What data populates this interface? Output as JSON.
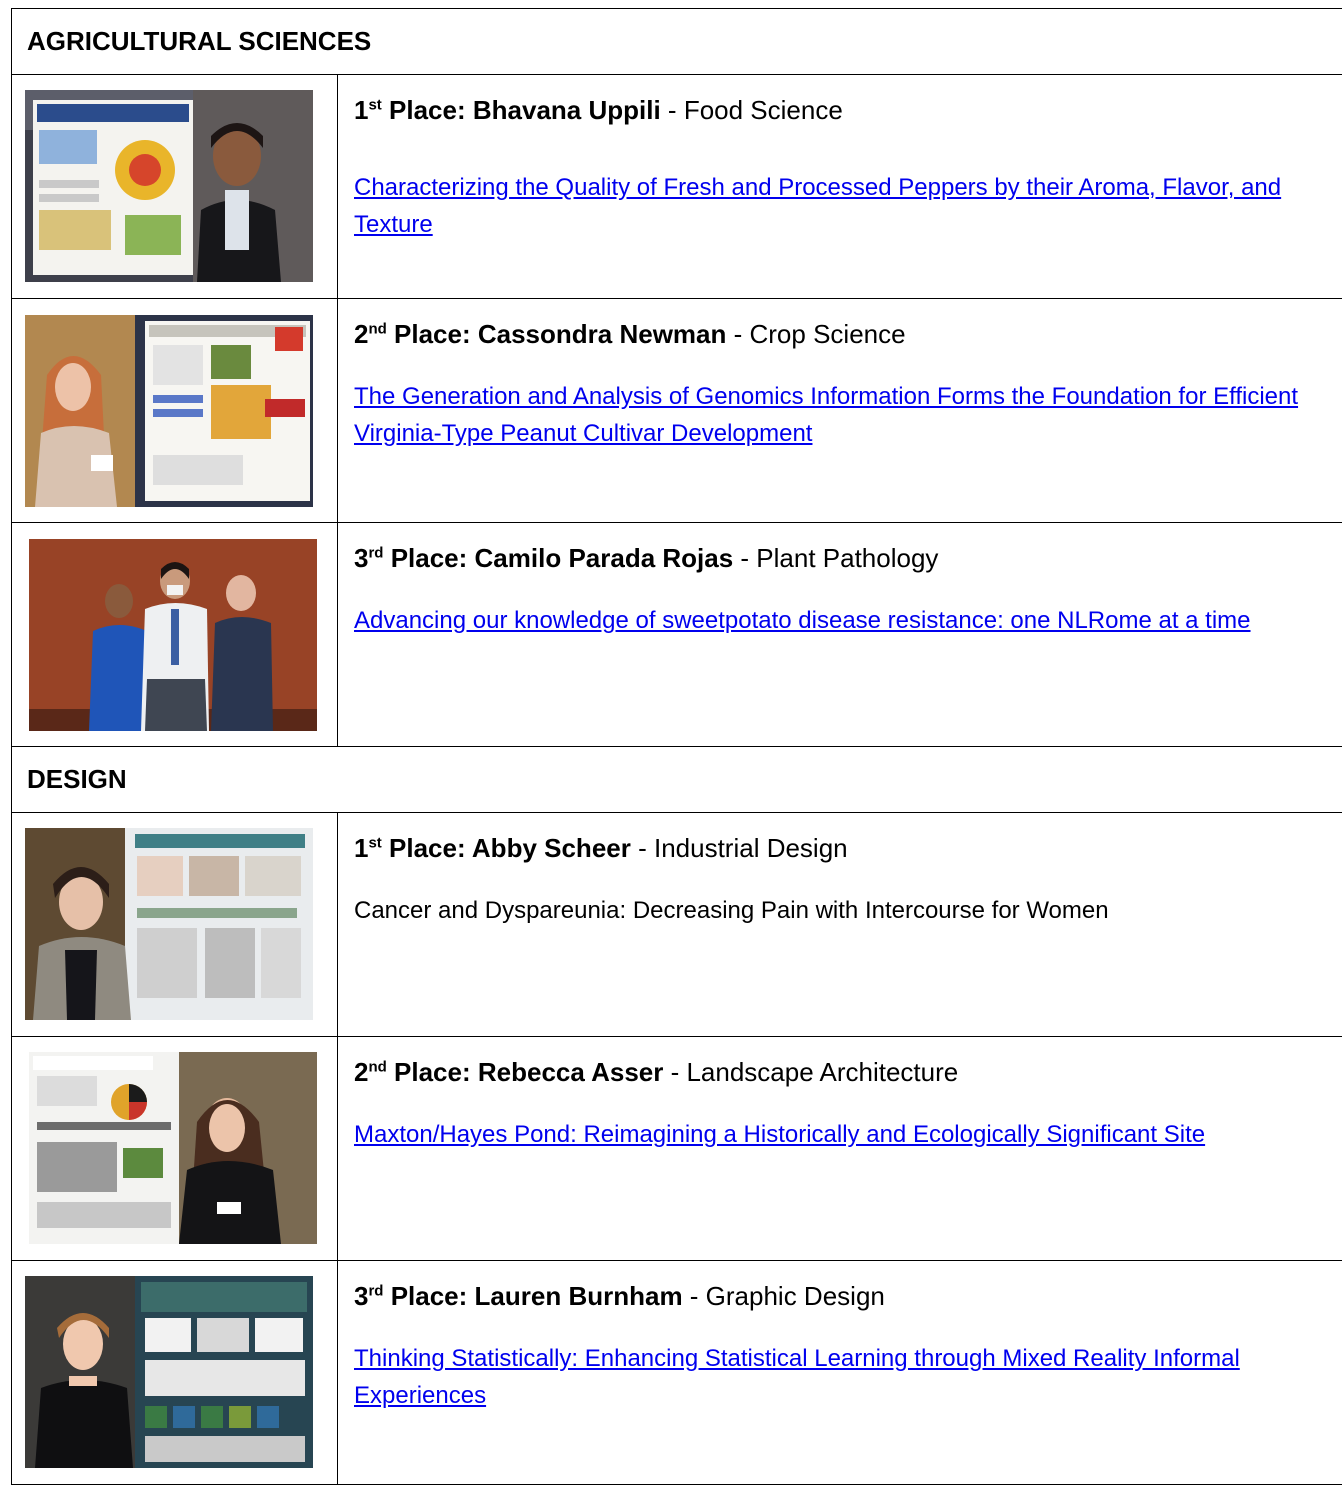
{
  "sections": [
    {
      "name": "AGRICULTURAL SCIENCES",
      "entries": [
        {
          "ordinal": "1",
          "suffix": "st",
          "place_label": " Place: ",
          "person": "Bhavana Uppili",
          "sep": " - ",
          "department": "Food Science",
          "title": "Characterizing the Quality of Fresh and Processed Peppers by their Aroma, Flavor, and Texture",
          "linked": true,
          "photo_icon": "poster-presenter-photo"
        },
        {
          "ordinal": "2",
          "suffix": "nd",
          "place_label": " Place: ",
          "person": "Cassondra Newman",
          "sep": " - ",
          "department": "Crop Science",
          "title": "The Generation and Analysis of Genomics Information Forms the Foundation for Efficient Virginia-Type Peanut Cultivar Development",
          "linked": true,
          "photo_icon": "poster-presenter-photo"
        },
        {
          "ordinal": "3",
          "suffix": "rd",
          "place_label": " Place: ",
          "person": "Camilo Parada Rojas",
          "sep": " - ",
          "department": "Plant Pathology",
          "title": "Advancing our knowledge of sweetpotato disease resistance: one NLRome at a time",
          "linked": true,
          "photo_icon": "group-photo"
        }
      ]
    },
    {
      "name": "DESIGN",
      "entries": [
        {
          "ordinal": "1",
          "suffix": "st",
          "place_label": " Place: ",
          "person": "Abby Scheer",
          "sep": " - ",
          "department": "Industrial Design",
          "title": "Cancer and Dyspareunia: Decreasing Pain with Intercourse for Women",
          "linked": false,
          "photo_icon": "poster-presenter-photo"
        },
        {
          "ordinal": "2",
          "suffix": "nd",
          "place_label": " Place: ",
          "person": "Rebecca Asser",
          "sep": " - ",
          "department": "Landscape Architecture",
          "title": "Maxton/Hayes Pond: Reimagining a Historically and Ecologically Significant Site",
          "linked": true,
          "photo_icon": "poster-presenter-photo"
        },
        {
          "ordinal": "3",
          "suffix": "rd",
          "place_label": " Place: ",
          "person": "Lauren Burnham",
          "sep": " - ",
          "department": "Graphic Design",
          "title": "Thinking Statistically: Enhancing Statistical Learning through Mixed Reality Informal Experiences",
          "linked": true,
          "photo_icon": "poster-presenter-photo"
        }
      ]
    }
  ],
  "colors": {
    "link": "#0000ee",
    "border": "#000000",
    "text": "#000000"
  }
}
